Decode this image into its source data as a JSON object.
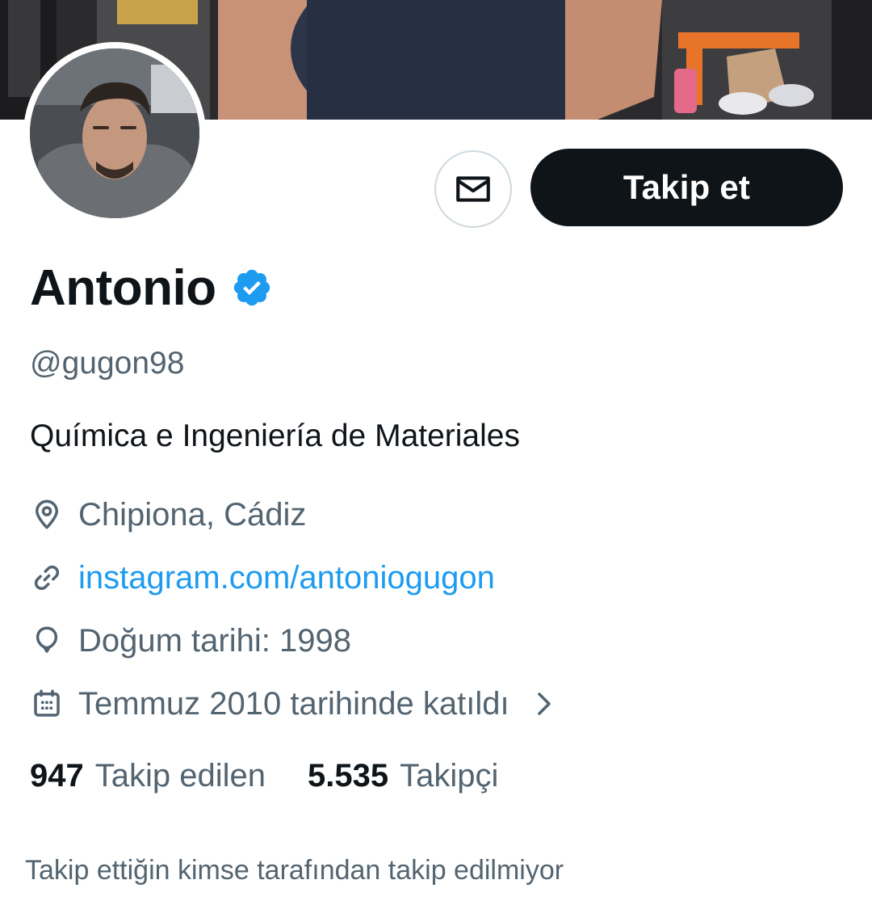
{
  "profile": {
    "display_name": "Antonio",
    "handle": "@gugon98",
    "bio": "Química e Ingeniería de Materiales",
    "verified": true,
    "verified_color": "#1d9bf0"
  },
  "actions": {
    "message_icon": "mail-icon",
    "follow_label": "Takip et"
  },
  "meta": {
    "location": "Chipiona, Cádiz",
    "location_icon": "location-pin-icon",
    "website": "instagram.com/antoniogugon",
    "website_icon": "link-icon",
    "birthday": "Doğum tarihi: 1998",
    "birthday_icon": "balloon-icon",
    "joined": "Temmuz 2010 tarihinde katıldı",
    "joined_icon": "calendar-icon"
  },
  "stats": {
    "following_count": "947",
    "following_label": "Takip edilen",
    "followers_count": "5.535",
    "followers_label": "Takipçi"
  },
  "footer": {
    "not_followed_text": "Takip ettiğin kimse tarafından takip edilmiyor"
  },
  "colors": {
    "text_primary": "#0f1419",
    "text_secondary": "#536471",
    "link": "#1d9bf0",
    "button_dark": "#0f1419",
    "border": "#cfd9de"
  }
}
